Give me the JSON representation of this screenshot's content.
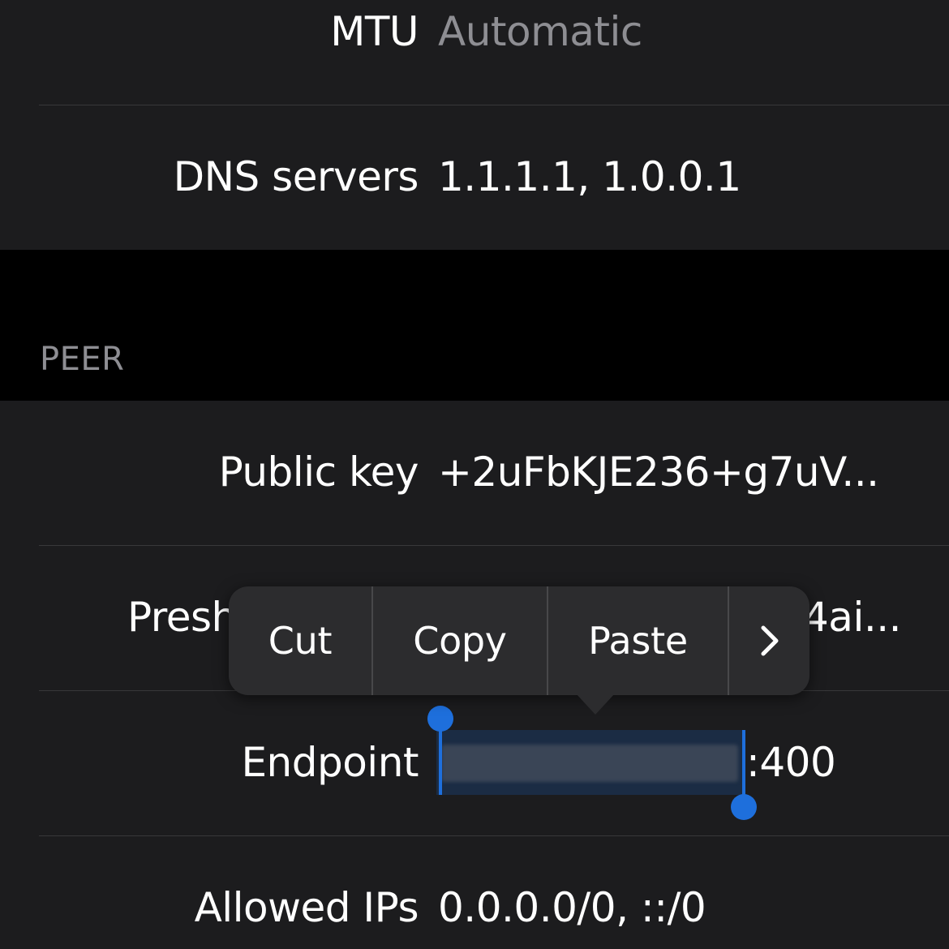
{
  "interface": {
    "mtu": {
      "label": "MTU",
      "value": "Automatic"
    },
    "dns": {
      "label": "DNS servers",
      "value": "1.1.1.1, 1.0.0.1"
    }
  },
  "peer": {
    "section_title": "PEER",
    "public_key": {
      "label": "Public key",
      "value": "+2uFbKJE236+g7uV..."
    },
    "preshared_key": {
      "label_visible": "Presh",
      "value_visible": "4ai..."
    },
    "endpoint": {
      "label": "Endpoint",
      "port_suffix": ":400"
    },
    "allowed_ips": {
      "label": "Allowed IPs",
      "value": "0.0.0.0/0, ::/0"
    }
  },
  "edit_menu": {
    "items": [
      "Cut",
      "Copy",
      "Paste"
    ],
    "more_glyph": "›"
  },
  "colors": {
    "background": "#000000",
    "cell": "#1c1c1e",
    "separator": "#38383a",
    "secondary_text": "#8e8e93",
    "selection": "#1e6fdc",
    "menu": "#2c2c2e"
  }
}
